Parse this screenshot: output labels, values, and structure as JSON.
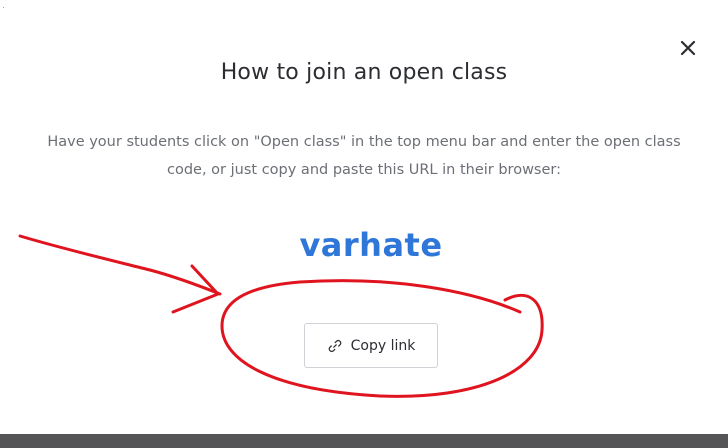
{
  "dialog": {
    "title": "How to join an open class",
    "description": "Have your students click on \"Open class\" in the top menu bar and enter the open class code, or just copy and paste this URL in their browser:",
    "class_code": "varhate",
    "copy_button_label": "Copy link",
    "close_icon": "close-icon",
    "link_icon": "link-icon"
  },
  "colors": {
    "title": "#2b2d33",
    "description": "#6c6f76",
    "class_code": "#2f76d9",
    "annotation": "#e0141e",
    "bottom_bar": "#555558"
  }
}
